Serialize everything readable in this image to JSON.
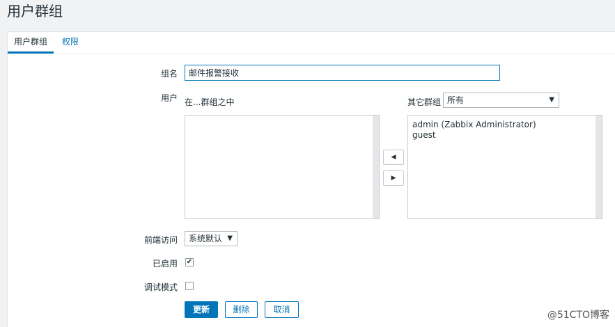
{
  "page": {
    "title": "用户群组"
  },
  "tabs": [
    {
      "label": "用户群组",
      "active": true
    },
    {
      "label": "权限",
      "active": false
    }
  ],
  "form": {
    "group_name_label": "组名",
    "group_name_value": "邮件报警接收",
    "users_label": "用户",
    "in_group_caption": "在...群组之中",
    "other_groups_caption": "其它群组",
    "other_groups_select": "所有",
    "in_group_users": [],
    "other_users": [
      "admin (Zabbix Administrator)",
      "guest"
    ],
    "move_left_glyph": "◀",
    "move_right_glyph": "▶",
    "frontend_access_label": "前端访问",
    "frontend_access_value": "系统默认",
    "enabled_label": "已启用",
    "enabled_checked": true,
    "debug_label": "调试模式",
    "debug_checked": false
  },
  "actions": {
    "update": "更新",
    "delete": "删除",
    "cancel": "取消"
  },
  "watermark": "@51CTO博客",
  "colors": {
    "accent": "#0275b8",
    "background": "#f0f2f4",
    "panel": "#ffffff"
  }
}
